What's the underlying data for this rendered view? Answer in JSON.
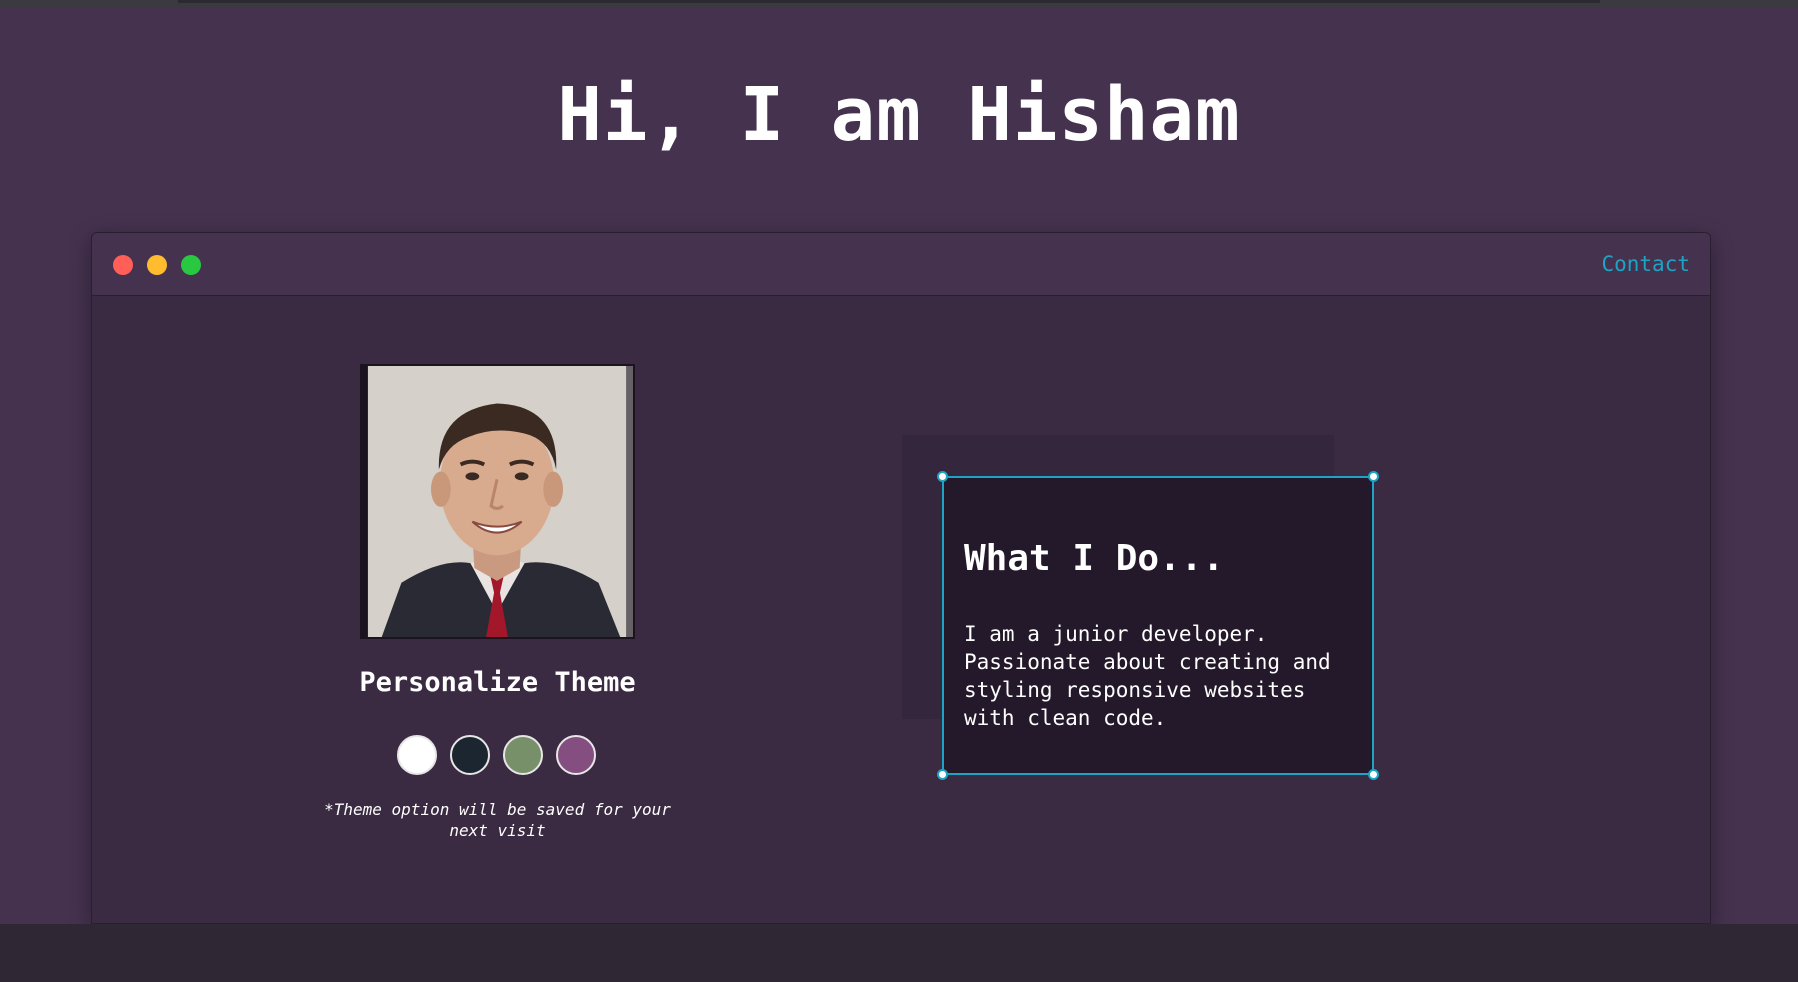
{
  "hero": {
    "title": "Hi, I am Hisham"
  },
  "window": {
    "controls": [
      "close",
      "minimize",
      "maximize"
    ],
    "nav": {
      "contact_label": "Contact"
    }
  },
  "profile": {
    "photo_icon": "profile-photo",
    "theme_title": "Personalize Theme",
    "swatches": [
      {
        "name": "light",
        "color": "#ffffff"
      },
      {
        "name": "blue",
        "color": "#1b2631"
      },
      {
        "name": "green",
        "color": "#78906a"
      },
      {
        "name": "purple",
        "color": "#844f80"
      }
    ],
    "note": "*Theme option will be saved for your next visit"
  },
  "about": {
    "title": "What I Do...",
    "body": "I am a junior developer.\nPassionate about creating and\nstyling responsive websites\nwith clean code."
  },
  "colors": {
    "background": "#45324f",
    "window_body": "#3a2a42",
    "accent": "#1ea3c4",
    "card": "#24192a"
  }
}
